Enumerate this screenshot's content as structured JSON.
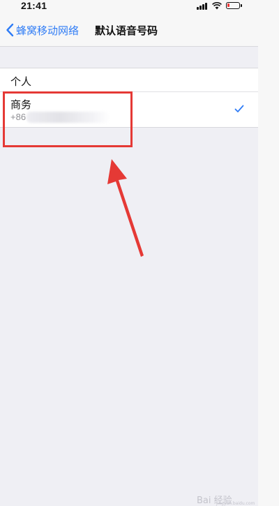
{
  "status_bar": {
    "time": "21:41"
  },
  "nav": {
    "back_label": "蜂窝移动网络",
    "title": "默认语音号码"
  },
  "list": {
    "items": [
      {
        "label": "个人",
        "selected": false
      },
      {
        "label": "商务",
        "number": "+86",
        "selected": true
      }
    ]
  },
  "watermark": {
    "text": "Bai 经验",
    "sub": "jingyan.baidu.com"
  },
  "colors": {
    "accent": "#2f7cf6",
    "annotation": "#e53935"
  }
}
